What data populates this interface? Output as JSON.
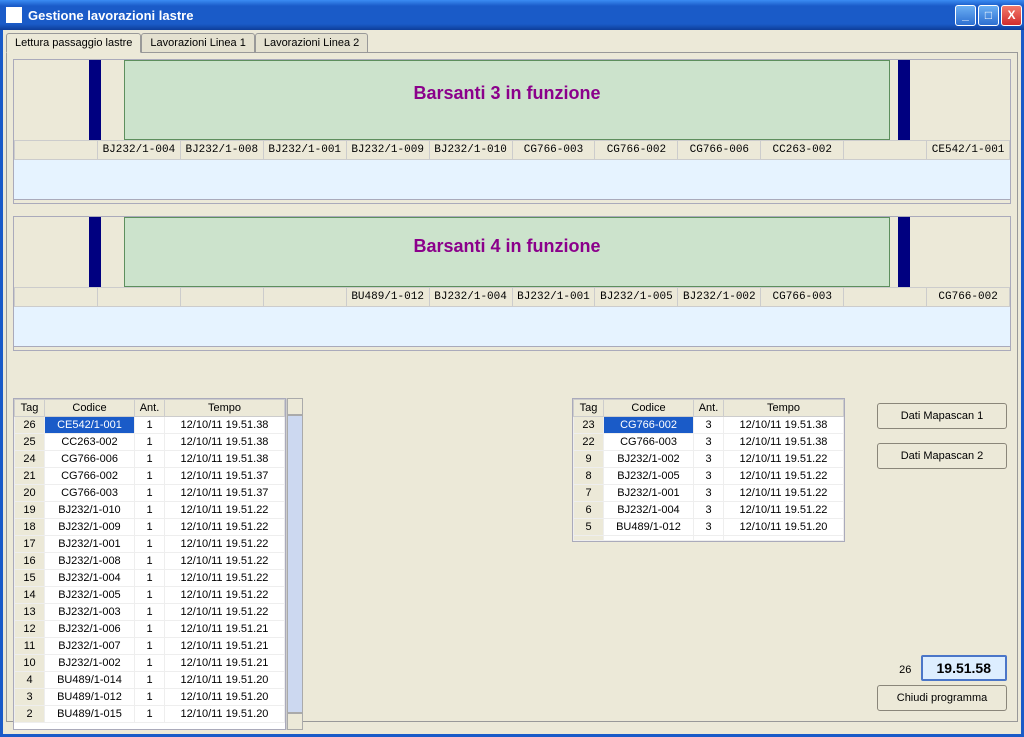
{
  "window": {
    "title": "Gestione lavorazioni lastre"
  },
  "tabs": [
    "Lettura passaggio lastre",
    "Lavorazioni Linea 1",
    "Lavorazioni Linea 2"
  ],
  "conveyors": [
    {
      "title": "Barsanti 3 in funzione",
      "slots": [
        "",
        "BJ232/1-004",
        "BJ232/1-008",
        "BJ232/1-001",
        "BJ232/1-009",
        "BJ232/1-010",
        "CG766-003",
        "CG766-002",
        "CG766-006",
        "CC263-002",
        "",
        "CE542/1-001"
      ]
    },
    {
      "title": "Barsanti 4 in funzione",
      "slots": [
        "",
        "",
        "",
        "",
        "BU489/1-012",
        "BJ232/1-004",
        "BJ232/1-001",
        "BJ232/1-005",
        "BJ232/1-002",
        "CG766-003",
        "",
        "CG766-002"
      ]
    }
  ],
  "grid_headers": [
    "Tag",
    "Codice",
    "Ant.",
    "Tempo"
  ],
  "grid1": [
    {
      "tag": "26",
      "codice": "CE542/1-001",
      "ant": "1",
      "tempo": "12/10/11 19.51.38",
      "sel": true
    },
    {
      "tag": "25",
      "codice": "CC263-002",
      "ant": "1",
      "tempo": "12/10/11 19.51.38"
    },
    {
      "tag": "24",
      "codice": "CG766-006",
      "ant": "1",
      "tempo": "12/10/11 19.51.38"
    },
    {
      "tag": "21",
      "codice": "CG766-002",
      "ant": "1",
      "tempo": "12/10/11 19.51.37"
    },
    {
      "tag": "20",
      "codice": "CG766-003",
      "ant": "1",
      "tempo": "12/10/11 19.51.37"
    },
    {
      "tag": "19",
      "codice": "BJ232/1-010",
      "ant": "1",
      "tempo": "12/10/11 19.51.22"
    },
    {
      "tag": "18",
      "codice": "BJ232/1-009",
      "ant": "1",
      "tempo": "12/10/11 19.51.22"
    },
    {
      "tag": "17",
      "codice": "BJ232/1-001",
      "ant": "1",
      "tempo": "12/10/11 19.51.22"
    },
    {
      "tag": "16",
      "codice": "BJ232/1-008",
      "ant": "1",
      "tempo": "12/10/11 19.51.22"
    },
    {
      "tag": "15",
      "codice": "BJ232/1-004",
      "ant": "1",
      "tempo": "12/10/11 19.51.22"
    },
    {
      "tag": "14",
      "codice": "BJ232/1-005",
      "ant": "1",
      "tempo": "12/10/11 19.51.22"
    },
    {
      "tag": "13",
      "codice": "BJ232/1-003",
      "ant": "1",
      "tempo": "12/10/11 19.51.22"
    },
    {
      "tag": "12",
      "codice": "BJ232/1-006",
      "ant": "1",
      "tempo": "12/10/11 19.51.21"
    },
    {
      "tag": "11",
      "codice": "BJ232/1-007",
      "ant": "1",
      "tempo": "12/10/11 19.51.21"
    },
    {
      "tag": "10",
      "codice": "BJ232/1-002",
      "ant": "1",
      "tempo": "12/10/11 19.51.21"
    },
    {
      "tag": "4",
      "codice": "BU489/1-014",
      "ant": "1",
      "tempo": "12/10/11 19.51.20"
    },
    {
      "tag": "3",
      "codice": "BU489/1-012",
      "ant": "1",
      "tempo": "12/10/11 19.51.20"
    },
    {
      "tag": "2",
      "codice": "BU489/1-015",
      "ant": "1",
      "tempo": "12/10/11 19.51.20"
    }
  ],
  "grid2": [
    {
      "tag": "23",
      "codice": "CG766-002",
      "ant": "3",
      "tempo": "12/10/11 19.51.38",
      "sel": true
    },
    {
      "tag": "22",
      "codice": "CG766-003",
      "ant": "3",
      "tempo": "12/10/11 19.51.38"
    },
    {
      "tag": "9",
      "codice": "BJ232/1-002",
      "ant": "3",
      "tempo": "12/10/11 19.51.22"
    },
    {
      "tag": "8",
      "codice": "BJ232/1-005",
      "ant": "3",
      "tempo": "12/10/11 19.51.22"
    },
    {
      "tag": "7",
      "codice": "BJ232/1-001",
      "ant": "3",
      "tempo": "12/10/11 19.51.22"
    },
    {
      "tag": "6",
      "codice": "BJ232/1-004",
      "ant": "3",
      "tempo": "12/10/11 19.51.22"
    },
    {
      "tag": "5",
      "codice": "BU489/1-012",
      "ant": "3",
      "tempo": "12/10/11 19.51.20"
    },
    {
      "tag": "",
      "codice": "",
      "ant": "",
      "tempo": ""
    }
  ],
  "buttons": {
    "mapascan1": "Dati Mapascan 1",
    "mapascan2": "Dati Mapascan 2",
    "closeprog": "Chiudi programma"
  },
  "clock": {
    "count": "26",
    "time": "19.51.58"
  }
}
